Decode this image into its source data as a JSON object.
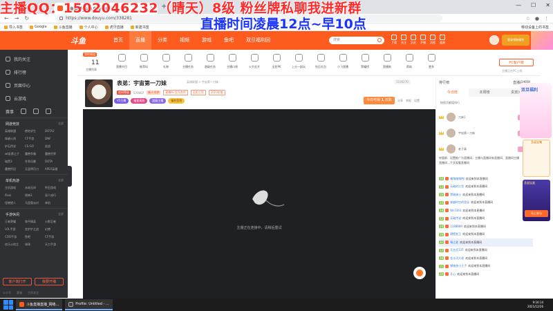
{
  "overlay": {
    "line1": "主播QQ：1502046232（晴天）8级 粉丝牌私聊我进新群",
    "line2": "直播时间凌晨12点~早10点"
  },
  "browser": {
    "tab_title": "斗鱼直播_斗鱼直播平台",
    "url": "https://www.douyu.com/338281",
    "bookmarks": [
      "导入书签",
      "Google",
      "斗鱼直播",
      "个人中心",
      "虎牙直播",
      "新建书签"
    ],
    "bookmarks_right": "移动设备上的书签"
  },
  "header": {
    "nav": [
      "首页",
      "直播",
      "分类",
      "视频",
      "游戏",
      "鱼吧",
      "双旦福利回"
    ],
    "nav_active_index": 1,
    "search_placeholder": "搜索",
    "icons": [
      "下载",
      "关注",
      "历史",
      "开播",
      "消息",
      "道具"
    ],
    "login": "登录领取福利"
  },
  "sidebar": {
    "main": [
      "我的关注",
      "排行榜",
      "页面中心",
      "云游戏"
    ],
    "icon_row_label": "赛事",
    "sections": [
      {
        "title": "网游竞技",
        "more": "全部",
        "items": [
          "英雄联盟",
          "绝地求生",
          "DOTA2",
          "穿越火线",
          "CF手游",
          "DNF",
          "炉石传说",
          "CS:GO",
          "逆战",
          "wt彩票之子",
          "魔兽争霸",
          "魔兽世界",
          "暗黑3",
          "冬季风暴",
          "DOTA",
          "魔兽怀旧",
          "天涯明月刀",
          "APEX英雄"
        ]
      },
      {
        "title": "单机热游",
        "more": "全部",
        "items": [
          "主机游戏",
          "永劫无间",
          "怀旧游戏",
          "Pixel",
          "原神3",
          "双人成行",
          "怪物猎人",
          "马里奥派对",
          "单机"
        ]
      },
      {
        "title": "手游休闲",
        "more": "全部",
        "items": [
          "王者荣耀",
          "和平精英",
          "火影忍者",
          "LOL手游",
          "金铲铲之战",
          "幻兽",
          "COD手游",
          "鱼吧",
          "CF手游",
          "欢乐斗地主",
          "球球",
          "天刀手游"
        ]
      }
    ],
    "btn_open": "客户端打开",
    "btn_live": "我要开播",
    "footer": [
      "公众号",
      "客服",
      "主机关注"
    ]
  },
  "categories": {
    "badge": "我的频道",
    "count": "11",
    "count_label": "主播列表",
    "items": [
      "直播节目",
      "推荐码",
      "礼物",
      "主播任务",
      "超级任务",
      "主播口袋",
      "火力全开",
      "全民PK",
      "上分一起玩",
      "钻石礼包",
      "小飞直播",
      "荣耀榜",
      "直播狗",
      "帮助",
      "更多"
    ],
    "pc_label": "PC客户端",
    "pc_sub": "主播正在PC上线"
  },
  "room": {
    "title": "表弟：宇宙第一刀妹",
    "crumb": "英雄联盟 > 宇宙第一刀妹",
    "tags": [
      "房间等级",
      "570007",
      "新人守护",
      "直播Ai-官方合作",
      "全民立项",
      "2023年度"
    ],
    "badges": [
      {
        "label": "V5主播",
        "color": "#7a5ce6"
      },
      {
        "label": "福星高照",
        "color": "#e64a8a"
      },
      {
        "label": "超级主播",
        "color": "#8a6ae6"
      },
      {
        "label": "福利签到",
        "color": "#f5c242"
      }
    ],
    "rank_today": "今日可得",
    "rank_value": "1",
    "rank_unit": "次数",
    "follow_count": "1100270",
    "ops": [
      "分享",
      "举报",
      "设置"
    ]
  },
  "player": {
    "message": "主播正在连接中，请稍后重试"
  },
  "rightpanel": {
    "head_left": "排行榜",
    "head_right": "直播间规则",
    "tabs": [
      "今日榜",
      "本周榜",
      "贵宾(0)"
    ],
    "note": "按照贡献值排行",
    "rank": [
      {
        "name": "刀妹1",
        "tag": "贵宾"
      },
      {
        "name": "宇宙第一刀妹",
        "tag": "贵宾"
      },
      {
        "name": "老子真",
        "tag": "贵宾"
      }
    ],
    "notice": "房管群、设置推广为直播间，主播与直播间有直播间、直播间主播直播间...下文观看直播间",
    "chat": [
      {
        "lv": "16",
        "name": "嘴角微扬MJ",
        "msg": "欢迎来到本直播间"
      },
      {
        "lv": "13",
        "name": "无敌的二货",
        "msg": "欢迎来到本直播间"
      },
      {
        "lv": "16",
        "name": "黑暗骑士",
        "msg": "欢迎来到本直播间"
      },
      {
        "lv": "24",
        "name": "穿越时空的思念",
        "msg": "欢迎来到本直播间"
      },
      {
        "lv": "18",
        "name": "Ws7363",
        "msg": "欢迎来到本直播间"
      },
      {
        "lv": "12",
        "name": "无敌传说",
        "msg": "欢迎来到本直播间"
      },
      {
        "lv": "10",
        "name": "1188889",
        "msg": "欢迎来到本直播间"
      },
      {
        "lv": "16",
        "name": "隔壁老王",
        "msg": "欢迎来到本直播间"
      },
      {
        "lv": "22",
        "name": "晴之夏",
        "msg": "欢迎来到本直播间"
      },
      {
        "lv": "13",
        "name": "无名氏337",
        "msg": "欢迎来到本直播间"
      },
      {
        "lv": "18",
        "name": "金水河大叔",
        "msg": "欢迎来到本直播间"
      },
      {
        "lv": "11",
        "name": "钢铁侠小王子",
        "msg": "欢迎来到本直播间"
      },
      {
        "lv": "20",
        "name": "开心",
        "msg": "欢迎来到本直播间"
      }
    ]
  },
  "ads": {
    "ad1": "双旦福利",
    "ad2": "圣诞宝箱",
    "ad3": "圣诞宝盒",
    "ad3_btn": "马上参与"
  },
  "taskbar": {
    "items": [
      "斗鱼直播直播_网络...",
      "Profile: Untitled - ..."
    ],
    "time": "9:16:14",
    "date": "2021/12/26"
  }
}
